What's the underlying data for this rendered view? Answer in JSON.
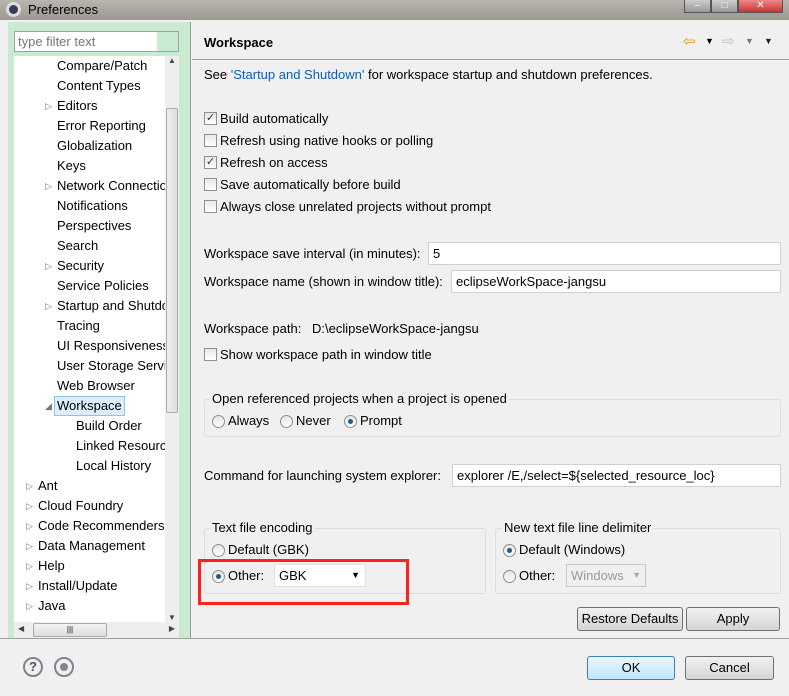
{
  "window": {
    "title": "Preferences"
  },
  "filter": {
    "placeholder": "type filter text"
  },
  "tree": [
    {
      "label": "Compare/Patch",
      "level": 1,
      "expandable": false
    },
    {
      "label": "Content Types",
      "level": 1,
      "expandable": false
    },
    {
      "label": "Editors",
      "level": 1,
      "expandable": true
    },
    {
      "label": "Error Reporting",
      "level": 1,
      "expandable": false
    },
    {
      "label": "Globalization",
      "level": 1,
      "expandable": false
    },
    {
      "label": "Keys",
      "level": 1,
      "expandable": false
    },
    {
      "label": "Network Connections",
      "level": 1,
      "expandable": true
    },
    {
      "label": "Notifications",
      "level": 1,
      "expandable": false
    },
    {
      "label": "Perspectives",
      "level": 1,
      "expandable": false
    },
    {
      "label": "Search",
      "level": 1,
      "expandable": false
    },
    {
      "label": "Security",
      "level": 1,
      "expandable": true
    },
    {
      "label": "Service Policies",
      "level": 1,
      "expandable": false
    },
    {
      "label": "Startup and Shutdown",
      "level": 1,
      "expandable": true
    },
    {
      "label": "Tracing",
      "level": 1,
      "expandable": false
    },
    {
      "label": "UI Responsiveness",
      "level": 1,
      "expandable": false
    },
    {
      "label": "User Storage Service",
      "level": 1,
      "expandable": false
    },
    {
      "label": "Web Browser",
      "level": 1,
      "expandable": false
    },
    {
      "label": "Workspace",
      "level": 1,
      "expandable": true,
      "expanded": true,
      "selected": true
    },
    {
      "label": "Build Order",
      "level": 2,
      "expandable": false
    },
    {
      "label": "Linked Resources",
      "level": 2,
      "expandable": false
    },
    {
      "label": "Local History",
      "level": 2,
      "expandable": false
    },
    {
      "label": "Ant",
      "level": 0,
      "expandable": true
    },
    {
      "label": "Cloud Foundry",
      "level": 0,
      "expandable": true
    },
    {
      "label": "Code Recommenders",
      "level": 0,
      "expandable": true
    },
    {
      "label": "Data Management",
      "level": 0,
      "expandable": true
    },
    {
      "label": "Help",
      "level": 0,
      "expandable": true
    },
    {
      "label": "Install/Update",
      "level": 0,
      "expandable": true
    },
    {
      "label": "Java",
      "level": 0,
      "expandable": true
    }
  ],
  "page": {
    "title": "Workspace",
    "see_prefix": "See ",
    "see_link": "'Startup and Shutdown'",
    "see_suffix": " for workspace startup and shutdown preferences.",
    "checks": [
      {
        "label": "Build automatically",
        "checked": true
      },
      {
        "label": "Refresh using native hooks or polling",
        "checked": false
      },
      {
        "label": "Refresh on access",
        "checked": true
      },
      {
        "label": "Save automatically before build",
        "checked": false
      },
      {
        "label": "Always close unrelated projects without prompt",
        "checked": false
      }
    ],
    "save_interval_label": "Workspace save interval (in minutes):",
    "save_interval_value": "5",
    "ws_name_label": "Workspace name (shown in window title):",
    "ws_name_value": "eclipseWorkSpace-jangsu",
    "ws_path_label": "Workspace path:",
    "ws_path_value": "D:\\eclipseWorkSpace-jangsu",
    "show_path_label": "Show workspace path in window title",
    "open_ref": {
      "title": "Open referenced projects when a project is opened",
      "options": [
        "Always",
        "Never",
        "Prompt"
      ],
      "selected": "Prompt"
    },
    "explorer_label": "Command for launching system explorer:",
    "explorer_value": "explorer /E,/select=${selected_resource_loc}",
    "encoding": {
      "title": "Text file encoding",
      "default_label": "Default (GBK)",
      "other_label": "Other:",
      "other_value": "GBK",
      "selected": "Other"
    },
    "delimiter": {
      "title": "New text file line delimiter",
      "default_label": "Default (Windows)",
      "other_label": "Other:",
      "other_value": "Windows",
      "selected": "Default"
    },
    "restore_defaults": "Restore Defaults",
    "apply": "Apply"
  },
  "footer": {
    "ok": "OK",
    "cancel": "Cancel"
  },
  "colors": {
    "highlight_box": "#ff2020",
    "left_panel": "#c8ebd1"
  }
}
